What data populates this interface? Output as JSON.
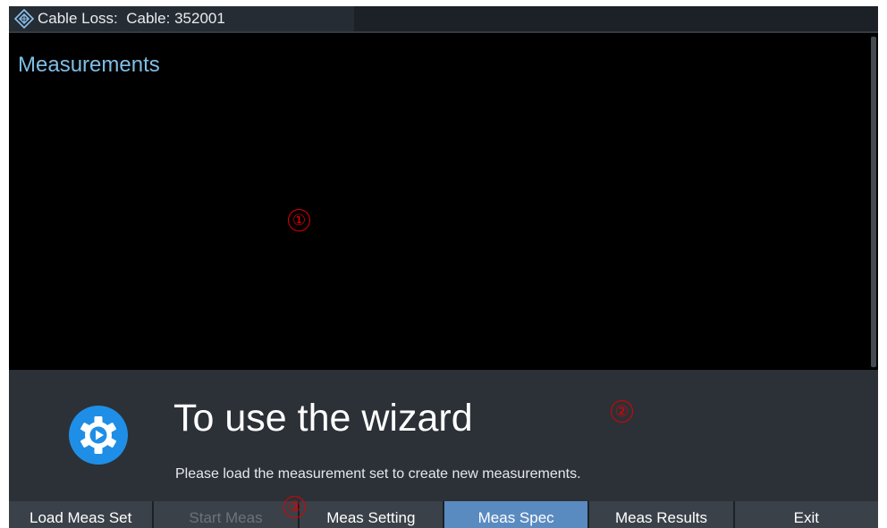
{
  "titlebar": {
    "title": "Cable Loss:  Cable: 352001",
    "logo_icon": "rohde-schwarz-diamond-logo"
  },
  "measurements": {
    "heading": "Measurements"
  },
  "callouts": {
    "one": "①",
    "two": "②",
    "three": "③"
  },
  "wizard": {
    "icon": "gear-play-icon",
    "heading": "To use the wizard",
    "message": "Please load the measurement set to create new measurements."
  },
  "softkeys": [
    {
      "label": "Load Meas Set",
      "state": "normal"
    },
    {
      "label": "Start Meas",
      "state": "disabled"
    },
    {
      "label": "Meas Setting",
      "state": "normal"
    },
    {
      "label": "Meas Spec",
      "state": "active"
    },
    {
      "label": "Meas Results",
      "state": "normal"
    },
    {
      "label": "Exit",
      "state": "normal"
    }
  ],
  "colors": {
    "accent_blue": "#5a8bc0",
    "title_blue": "#7fbde6",
    "callout_red": "#e00000",
    "wizard_icon_blue": "#1f8ee6"
  }
}
